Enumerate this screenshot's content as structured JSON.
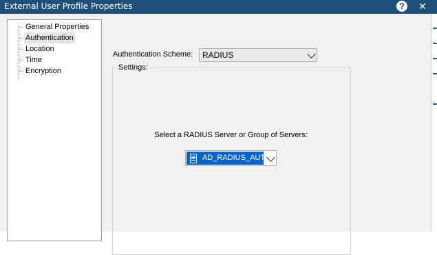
{
  "window": {
    "title": "External User Profile Properties",
    "help_label": "?",
    "close_label": "✕"
  },
  "tree": {
    "items": [
      {
        "label": "General Properties",
        "selected": false
      },
      {
        "label": "Authentication",
        "selected": true
      },
      {
        "label": "Location",
        "selected": false
      },
      {
        "label": "Time",
        "selected": false
      },
      {
        "label": "Encryption",
        "selected": false
      }
    ]
  },
  "auth": {
    "scheme_label": "Authentication Scheme:",
    "scheme_value": "RADIUS"
  },
  "settings": {
    "legend": "Settings:",
    "server_label": "Select a RADIUS Server or Group of Servers:",
    "server_value": "AD_RADIUS_AUTH"
  },
  "colors": {
    "titlebar": "#1f4e79",
    "selection": "#0a64c8"
  }
}
